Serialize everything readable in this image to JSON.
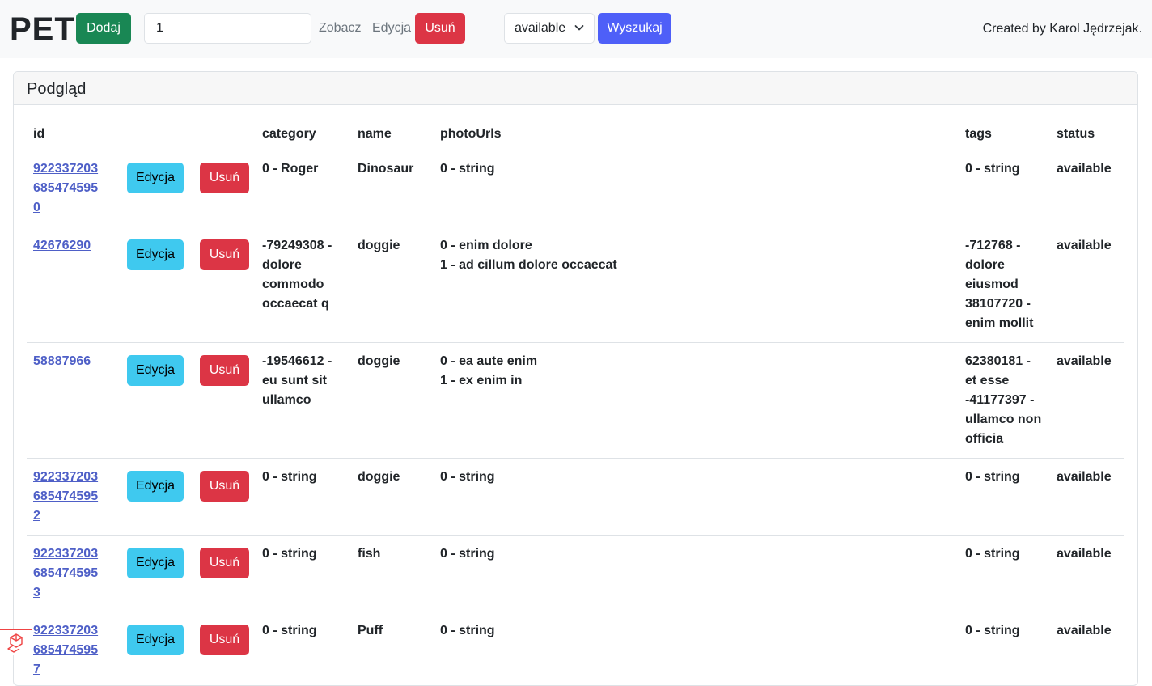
{
  "header": {
    "brand": "PET",
    "add_label": "Dodaj",
    "id_value": "1",
    "view_label": "Zobacz",
    "edit_label": "Edycja",
    "delete_label": "Usuń",
    "status_selected": "available",
    "search_label": "Wyszukaj",
    "credit": "Created by Karol Jędrzejak."
  },
  "card": {
    "title": "Podgląd"
  },
  "table": {
    "columns": [
      "id",
      "",
      "",
      "category",
      "name",
      "photoUrls",
      "tags",
      "status"
    ],
    "edit_label": "Edycja",
    "delete_label": "Usuń",
    "rows": [
      {
        "id": [
          "922337203",
          "685474595",
          "0"
        ],
        "category": [
          "0 - Roger"
        ],
        "name": "Dinosaur",
        "photoUrls": [
          "0 - string"
        ],
        "tags": [
          "0 - string"
        ],
        "status": "available"
      },
      {
        "id": [
          "42676290"
        ],
        "category": [
          "-79249308 -",
          "dolore",
          "commodo",
          "occaecat q"
        ],
        "name": "doggie",
        "photoUrls": [
          "0 - enim dolore",
          "1 - ad cillum dolore occaecat"
        ],
        "tags": [
          "-712768 -",
          "dolore",
          "eiusmod",
          "38107720 -",
          "enim mollit"
        ],
        "status": "available"
      },
      {
        "id": [
          "58887966"
        ],
        "category": [
          "-19546612 -",
          "eu sunt sit",
          "ullamco"
        ],
        "name": "doggie",
        "photoUrls": [
          "0 - ea aute enim",
          "1 - ex enim in"
        ],
        "tags": [
          "62380181 -",
          "et esse",
          "-41177397 -",
          "ullamco non",
          "officia"
        ],
        "status": "available"
      },
      {
        "id": [
          "922337203",
          "685474595",
          "2"
        ],
        "category": [
          "0 - string"
        ],
        "name": "doggie",
        "photoUrls": [
          "0 - string"
        ],
        "tags": [
          "0 - string"
        ],
        "status": "available"
      },
      {
        "id": [
          "922337203",
          "685474595",
          "3"
        ],
        "category": [
          "0 - string"
        ],
        "name": "fish",
        "photoUrls": [
          "0 - string"
        ],
        "tags": [
          "0 - string"
        ],
        "status": "available"
      },
      {
        "id": [
          "922337203",
          "685474595",
          "7"
        ],
        "category": [
          "0 - string"
        ],
        "name": "Puff",
        "photoUrls": [
          "0 - string"
        ],
        "tags": [
          "0 - string"
        ],
        "status": "available"
      }
    ]
  },
  "colors": {
    "green": "#198754",
    "red": "#dc3545",
    "blue": "#4e5ff8",
    "cyan": "#3fc9ef",
    "link": "#4e5fc7"
  }
}
